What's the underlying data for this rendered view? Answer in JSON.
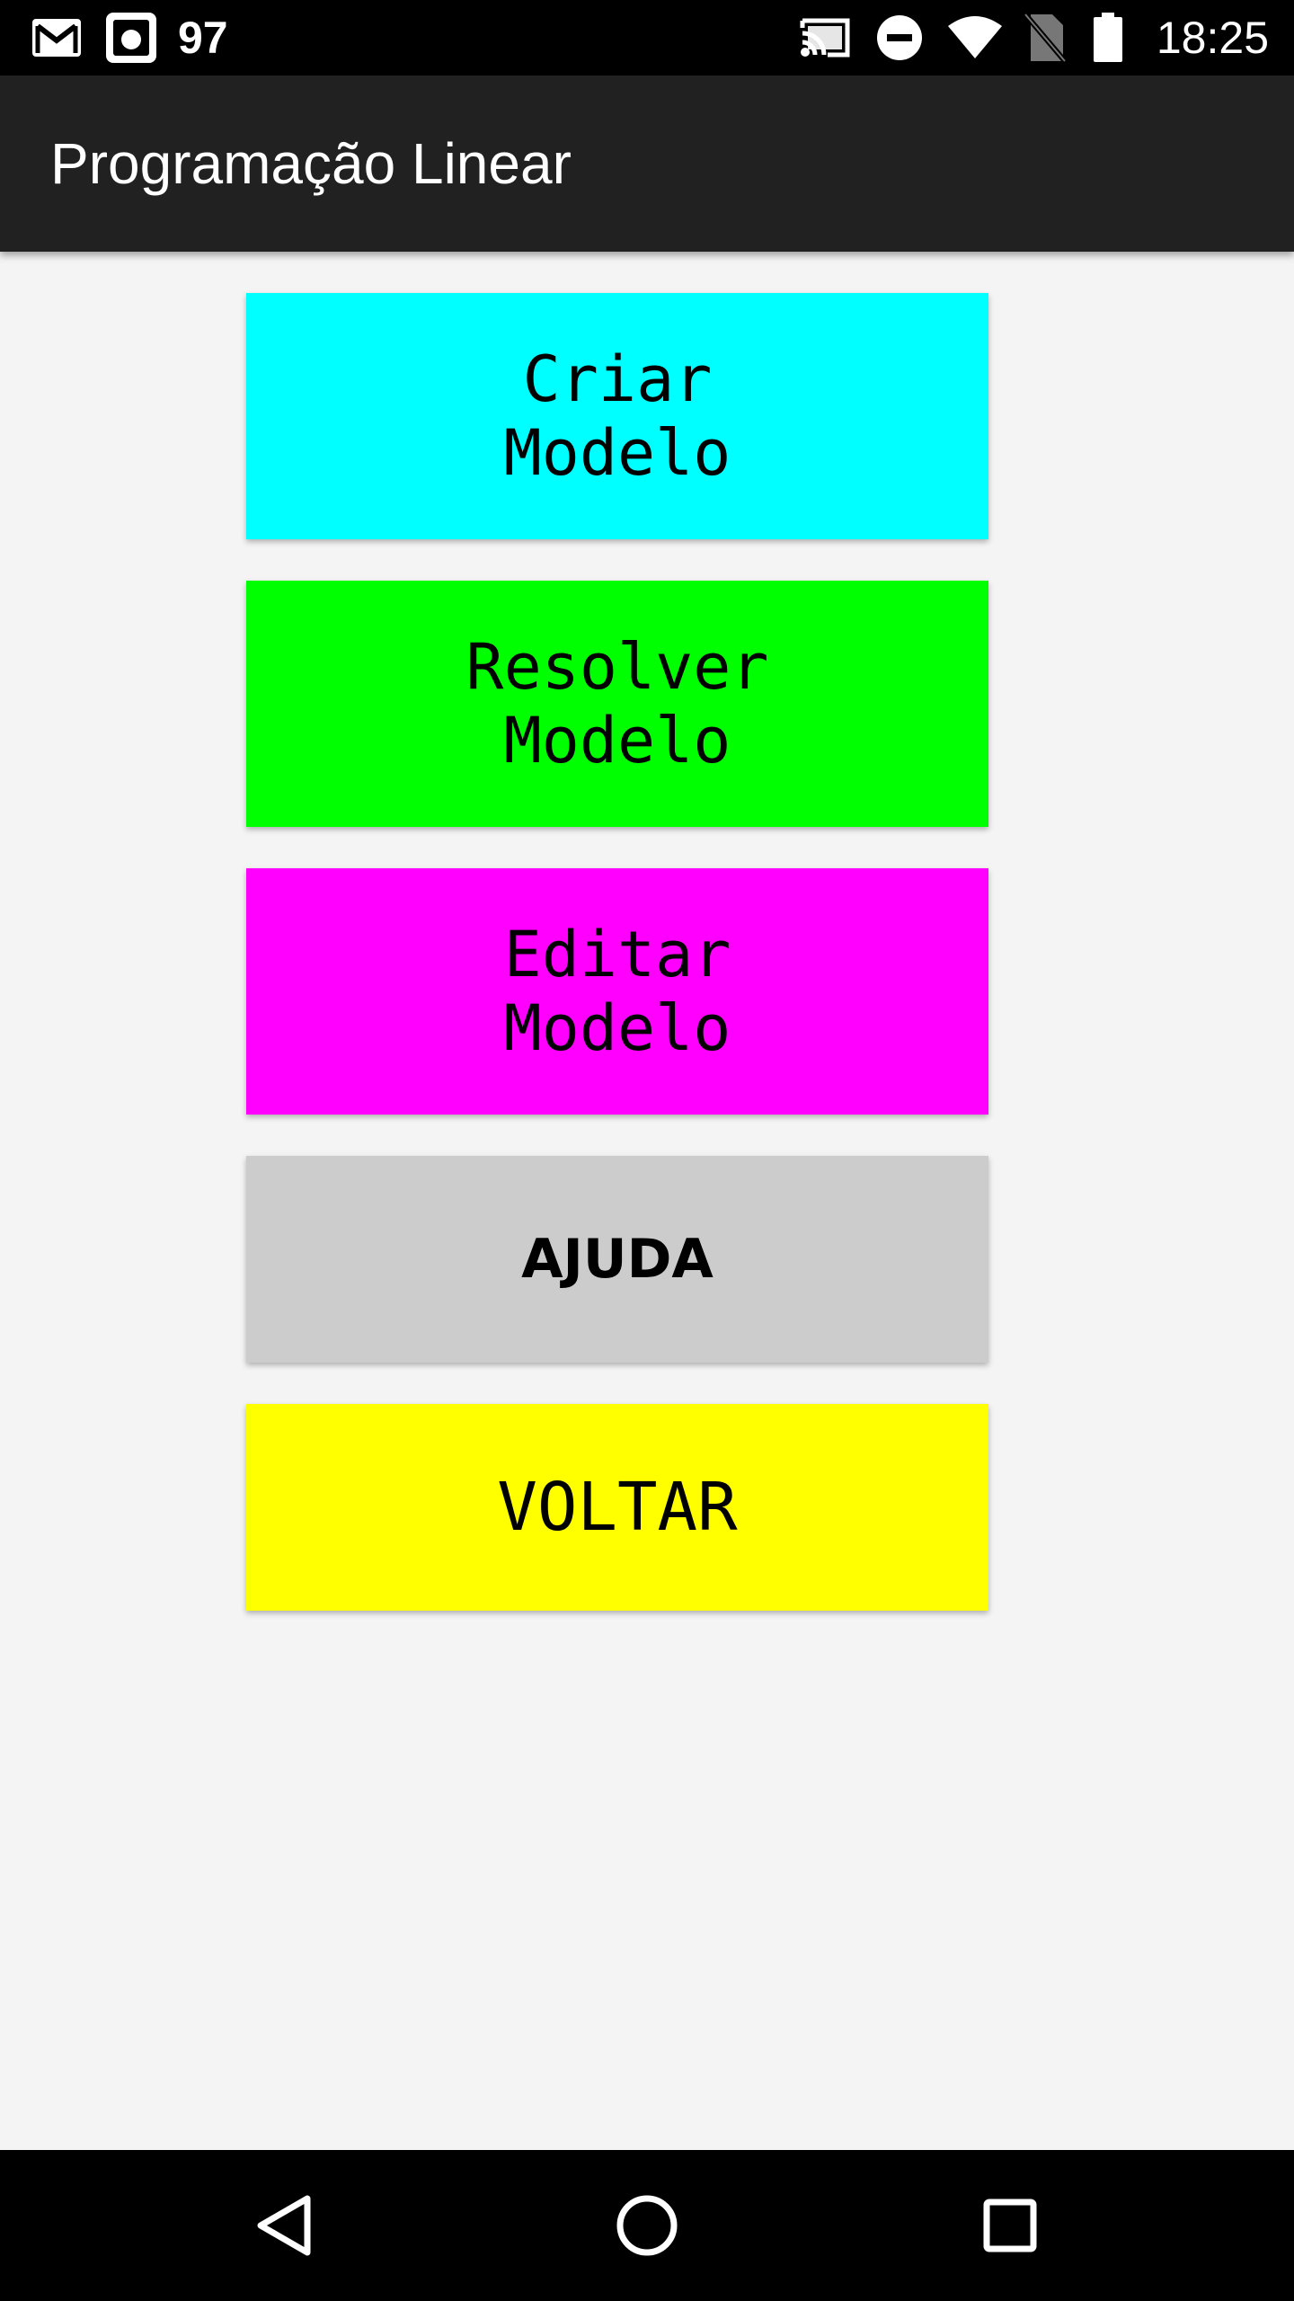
{
  "status_bar": {
    "notification_count": "97",
    "time": "18:25",
    "icons": [
      "gmail-icon",
      "photo-icon",
      "cast-icon",
      "do-not-disturb-icon",
      "wifi-icon",
      "no-sim-icon",
      "battery-icon"
    ]
  },
  "app_bar": {
    "title": "Programação Linear"
  },
  "menu": {
    "buttons": [
      {
        "label": "Criar\nModelo",
        "color": "#00ffff"
      },
      {
        "label": "Resolver\nModelo",
        "color": "#00ff00"
      },
      {
        "label": "Editar\nModelo",
        "color": "#ff00ff"
      },
      {
        "label": "AJUDA",
        "color": "#cccccc"
      },
      {
        "label": "VOLTAR",
        "color": "#ffff00"
      }
    ]
  },
  "nav_bar": {
    "icons": [
      "back-icon",
      "home-icon",
      "recents-icon"
    ]
  }
}
